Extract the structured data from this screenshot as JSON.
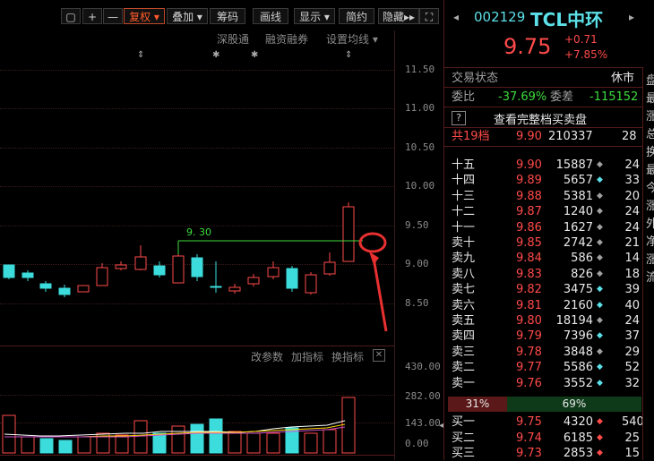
{
  "toolbar": {
    "buttons": [
      "+",
      "—",
      "复权",
      "叠加",
      "筹码",
      "画线",
      "显示",
      "简约",
      "隐藏"
    ],
    "more": "▸▸"
  },
  "chart": {
    "sub_menu": [
      "深股通",
      "融资融券",
      "设置均线"
    ],
    "y_labels": [
      "11.50",
      "11.00",
      "10.50",
      "10.00",
      "9.50",
      "9.00",
      "8.50"
    ],
    "annotation": "9. 30",
    "indicator_bar": [
      "改参数",
      "加指标",
      "换指标"
    ],
    "vol_labels": [
      "430.00",
      "282.00",
      "143.00",
      "0.00"
    ],
    "colors": {
      "up": "#ff4a4a",
      "down": "#3cdcdc",
      "ma": "#ffffff",
      "ma2": "#ffd700"
    }
  },
  "quote": {
    "code": "002129",
    "name": "TCL中环",
    "price": "9.75",
    "change": "+0.71",
    "change_pct": "+7.85%",
    "status_label": "交易状态",
    "status_value": "休市",
    "weibi_label": "委比",
    "weibi_value": "-37.69%",
    "weicha_label": "委差",
    "weicha_value": "-115152",
    "full_book": "查看完整档买卖盘",
    "total_label": "共19档",
    "total_price": "9.90",
    "total_vol": "210337",
    "total_count": "28",
    "asks": [
      {
        "label": "十五",
        "price": "9.90",
        "vol": "15887",
        "count": "24"
      },
      {
        "label": "十四",
        "price": "9.89",
        "vol": "5657",
        "count": "33"
      },
      {
        "label": "十三",
        "price": "9.88",
        "vol": "5381",
        "count": "20"
      },
      {
        "label": "十二",
        "price": "9.87",
        "vol": "1240",
        "count": "24"
      },
      {
        "label": "十一",
        "price": "9.86",
        "vol": "1627",
        "count": "24"
      },
      {
        "label": "卖十",
        "price": "9.85",
        "vol": "2742",
        "count": "21"
      },
      {
        "label": "卖九",
        "price": "9.84",
        "vol": "586",
        "count": "14"
      },
      {
        "label": "卖八",
        "price": "9.83",
        "vol": "826",
        "count": "18"
      },
      {
        "label": "卖七",
        "price": "9.82",
        "vol": "3475",
        "count": "39"
      },
      {
        "label": "卖六",
        "price": "9.81",
        "vol": "2160",
        "count": "40"
      },
      {
        "label": "卖五",
        "price": "9.80",
        "vol": "18194",
        "count": "24"
      },
      {
        "label": "卖四",
        "price": "9.79",
        "vol": "7396",
        "count": "37"
      },
      {
        "label": "卖三",
        "price": "9.78",
        "vol": "3848",
        "count": "29"
      },
      {
        "label": "卖二",
        "price": "9.77",
        "vol": "5586",
        "count": "52"
      },
      {
        "label": "卖一",
        "price": "9.76",
        "vol": "3552",
        "count": "32"
      }
    ],
    "ratio_left": "31%",
    "ratio_right": "69%",
    "bids": [
      {
        "label": "买一",
        "price": "9.75",
        "vol": "4320",
        "count": "540"
      },
      {
        "label": "买二",
        "price": "9.74",
        "vol": "6185",
        "count": "25"
      },
      {
        "label": "买三",
        "price": "9.73",
        "vol": "2853",
        "count": "15"
      }
    ],
    "side_chars": [
      "盘",
      "最",
      "涨",
      "总",
      "换",
      "最",
      "今",
      "涨",
      "外",
      "净",
      "涨",
      "流"
    ]
  }
}
